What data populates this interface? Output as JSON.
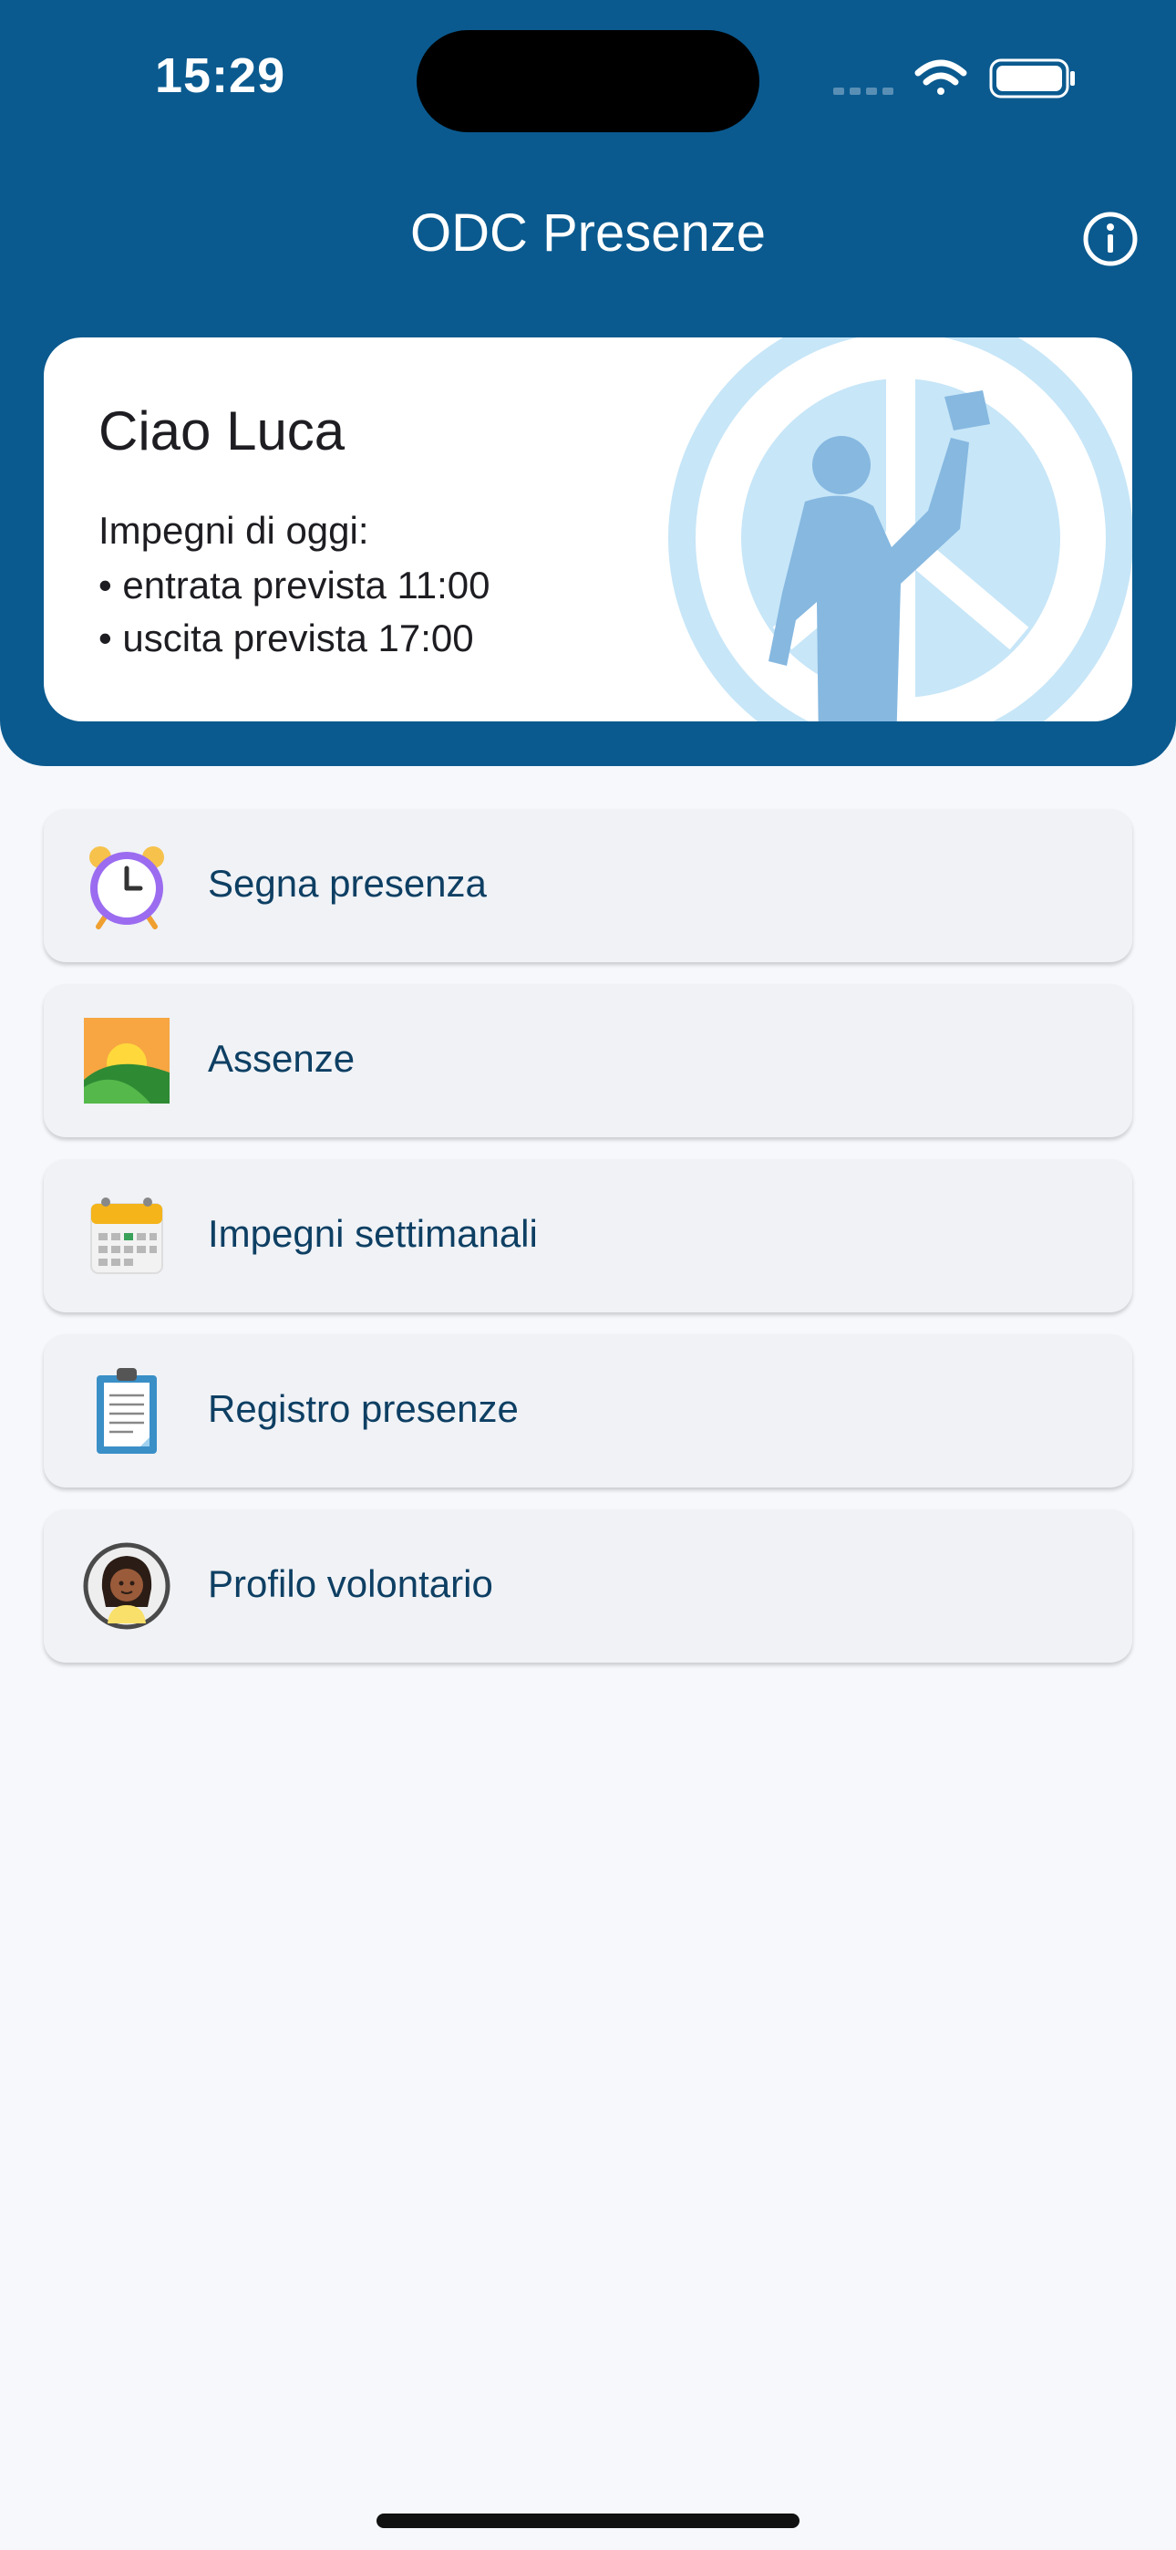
{
  "status_bar": {
    "time": "15:29",
    "icons": [
      "cellular-icon",
      "wifi-icon",
      "battery-icon"
    ]
  },
  "header": {
    "title": "ODC Presenze",
    "info_icon": "info-icon"
  },
  "greeting_card": {
    "greeting": "Ciao Luca",
    "today_label": "Impegni di oggi:",
    "commitments": [
      "• entrata prevista 11:00",
      "• uscita prevista 17:00"
    ],
    "illustration": "peace-sign-person-illustration"
  },
  "menu": [
    {
      "label": "Segna presenza",
      "icon": "alarm-clock-icon"
    },
    {
      "label": "Assenze",
      "icon": "sunrise-landscape-icon"
    },
    {
      "label": "Impegni settimanali",
      "icon": "calendar-icon"
    },
    {
      "label": "Registro presenze",
      "icon": "clipboard-icon"
    },
    {
      "label": "Profilo volontario",
      "icon": "avatar-icon"
    }
  ],
  "colors": {
    "header": "#0a5a8f",
    "menu_text": "#0e3f63",
    "background": "#f6f8fc"
  }
}
